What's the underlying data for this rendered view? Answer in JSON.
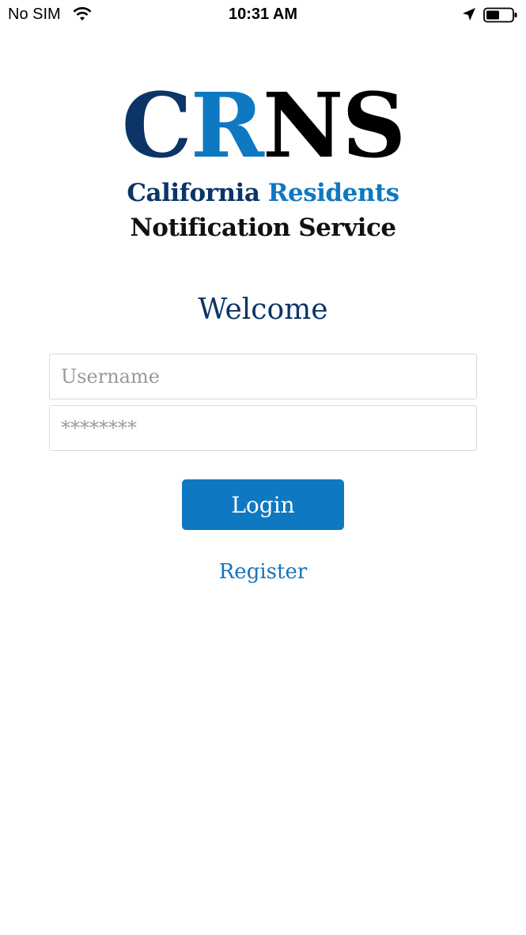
{
  "status_bar": {
    "carrier": "No SIM",
    "time": "10:31 AM",
    "icons": [
      "wifi-icon",
      "location-arrow-icon",
      "battery-icon"
    ]
  },
  "logo": {
    "mark_c": "C",
    "mark_r": "R",
    "mark_ns": "NS",
    "line1_a": "California",
    "line1_b": "Residents",
    "line2": "Notification Service"
  },
  "welcome": "Welcome",
  "form": {
    "username_placeholder": "Username",
    "username_value": "",
    "password_placeholder": "********",
    "password_value": "",
    "login_label": "Login",
    "register_label": "Register"
  },
  "colors": {
    "brand_dark": "#0b3566",
    "brand_blue": "#0f78c2",
    "link_blue": "#1575b8"
  }
}
